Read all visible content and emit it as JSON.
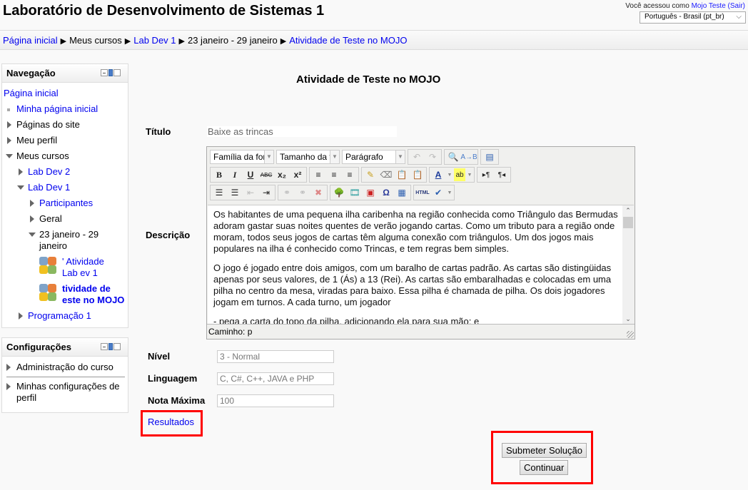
{
  "header": {
    "site_title": "Laboratório de Desenvolvimento de Sistemas 1",
    "login_prefix": "Você acessou como",
    "user_name": "Mojo Teste",
    "logout_label": "(Sair)",
    "language_selected": "Português - Brasil (pt_br)"
  },
  "breadcrumb": [
    {
      "label": "Página inicial",
      "link": true
    },
    {
      "label": "Meus cursos",
      "link": false
    },
    {
      "label": "Lab Dev 1",
      "link": true
    },
    {
      "label": "23 janeiro - 29 janeiro",
      "link": false
    },
    {
      "label": "Atividade de Teste no MOJO",
      "link": true
    }
  ],
  "navigation": {
    "title": "Navegação",
    "items": [
      {
        "label": "Página inicial"
      },
      {
        "label": "Minha página inicial"
      },
      {
        "label": "Páginas do site"
      },
      {
        "label": "Meu perfil"
      },
      {
        "label": "Meus cursos"
      },
      {
        "label": "Lab Dev 2"
      },
      {
        "label": "Lab Dev 1"
      },
      {
        "label": "Participantes"
      },
      {
        "label": "Geral"
      },
      {
        "label": "23 janeiro - 29 janeiro"
      },
      {
        "label": "' Atividade Lab ev 1"
      },
      {
        "label": "tividade de este no MOJO"
      },
      {
        "label": "Programação 1"
      }
    ]
  },
  "settings": {
    "title": "Configurações",
    "items": [
      {
        "label": "Administração do curso"
      },
      {
        "label": "Minhas configurações de perfil"
      }
    ]
  },
  "main": {
    "title": "Atividade de Teste no MOJO",
    "titulo_label": "Título",
    "titulo_value": "Baixe as trincas",
    "descricao_label": "Descrição",
    "editor": {
      "font_family": "Família da font",
      "font_size": "Tamanho da fo",
      "format": "Parágrafo",
      "paragraphs": [
        "Os habitantes de uma pequena ilha caribenha na região conhecida como Triângulo das Bermudas adoram gastar suas noites quentes de verão jogando cartas. Como um tributo para a região onde moram, todos seus jogos de cartas têm alguma conexão com triângulos. Um dos jogos mais populares na ilha é conhecido como Trincas, e tem regras bem simples.",
        "O jogo é jogado entre dois amigos, com um baralho de cartas padrão. As cartas são distingüidas apenas por seus valores, de 1 (Ás) a 13 (Rei). As cartas são embaralhadas e colocadas em uma pilha no centro da mesa, viradas para baixo. Essa pilha é chamada de pilha. Os dois jogadores jogam em turnos. A cada turno, um jogador",
        "- pega a carta do topo da pilha, adicionando ela para sua mão; e"
      ],
      "status_path": "Caminho: p"
    },
    "nivel_label": "Nível",
    "nivel_value": "3 - Normal",
    "linguagem_label": "Linguagem",
    "linguagem_value": "C, C#, C++, JAVA e PHP",
    "nota_label": "Nota Máxima",
    "nota_value": "100",
    "resultados_label": "Resultados",
    "submit_label": "Submeter Solução",
    "continue_label": "Continuar"
  },
  "colors": {
    "link": "#0000ee",
    "highlight": "#ff0000"
  }
}
